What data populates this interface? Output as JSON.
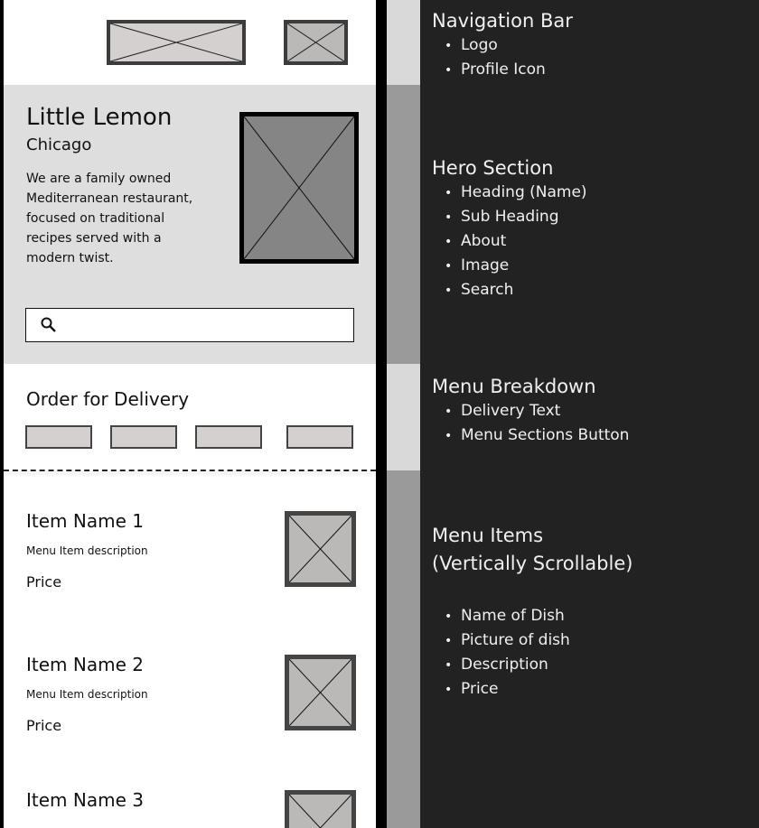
{
  "app": {
    "nav": {
      "logo_icon": "image-placeholder",
      "profile_icon": "image-placeholder"
    },
    "hero": {
      "title": "Little Lemon",
      "subtitle": "Chicago",
      "about": [
        "We are a family owned",
        "Mediterranean restaurant,",
        "focused on traditional",
        "recipes served with a",
        "modern twist."
      ],
      "search_icon": "search-icon",
      "search_value": ""
    },
    "delivery": {
      "title": "Order for Delivery"
    },
    "menu_items": [
      {
        "name": "Item Name 1",
        "description": "Menu Item description",
        "price": "Price"
      },
      {
        "name": "Item Name 2",
        "description": "Menu Item description",
        "price": "Price"
      },
      {
        "name": "Item Name 3"
      }
    ]
  },
  "annotations": {
    "nav": {
      "title": "Navigation Bar",
      "items": [
        "Logo",
        "Profile Icon"
      ]
    },
    "hero": {
      "title": "Hero Section",
      "items": [
        "Heading (Name)",
        "Sub Heading",
        "About",
        "Image",
        "Search"
      ]
    },
    "breakdown": {
      "title": "Menu Breakdown",
      "items": [
        "Delivery Text",
        "Menu Sections Button"
      ]
    },
    "menu": {
      "title_line1": "Menu Items",
      "title_line2": "(Vertically Scrollable)",
      "items": [
        "Name of Dish",
        "Picture of dish",
        "Description",
        "Price"
      ]
    }
  },
  "colors": {
    "panel": "#222222",
    "hero_bg": "#dedede",
    "frame": "#000000"
  }
}
